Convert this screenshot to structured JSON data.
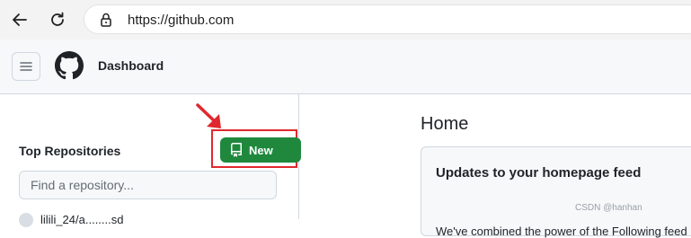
{
  "browser": {
    "url": "https://github.com",
    "back_icon": "arrow-left-icon",
    "reload_icon": "reload-icon",
    "lock_icon": "lock-icon"
  },
  "header": {
    "menu_icon": "hamburger-icon",
    "logo_icon": "github-logo-icon",
    "title": "Dashboard"
  },
  "sidebar": {
    "section_title": "Top Repositories",
    "new_button_label": "New",
    "new_button_icon": "repo-icon",
    "search_placeholder": "Find a repository...",
    "repos": [
      {
        "name": "lilili_24/a........sd"
      }
    ]
  },
  "main": {
    "title": "Home",
    "card": {
      "title": "Updates to your homepage feed",
      "body": "We've combined the power of the Following feed"
    }
  },
  "watermark": "CSDN @hanhan",
  "colors": {
    "accent_green": "#1f883d",
    "highlight_red": "#e0282e"
  }
}
